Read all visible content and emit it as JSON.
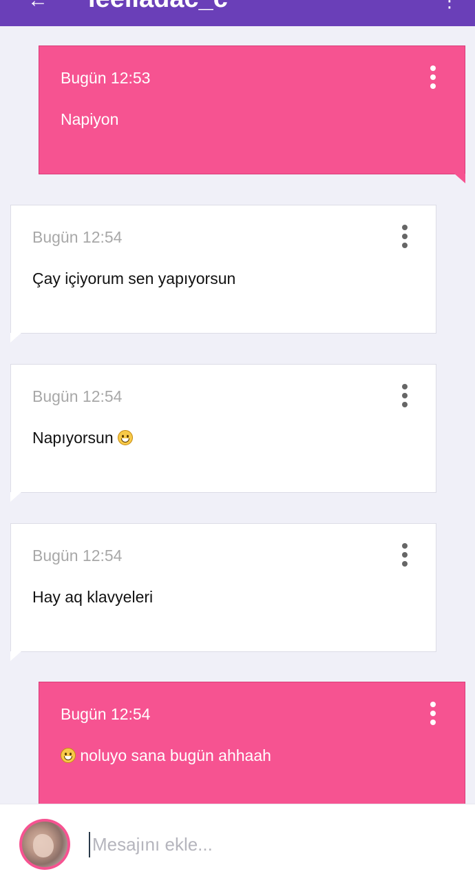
{
  "header": {
    "back_icon": "arrow-left-icon",
    "title": "leeiladac_c",
    "menu_icon": "more-vertical-icon",
    "background": "#6a3fb8"
  },
  "messages": [
    {
      "direction": "outgoing",
      "time": "Bugün 12:53",
      "text": "Napiyon",
      "emoji": null,
      "menu_icon": "more-vertical-icon"
    },
    {
      "direction": "incoming",
      "time": "Bugün 12:54",
      "text": "Çay içiyorum sen yapıyorsun",
      "emoji": null,
      "menu_icon": "more-vertical-icon"
    },
    {
      "direction": "incoming",
      "time": "Bugün 12:54",
      "text": "Napıyorsun",
      "emoji": "grinning-face-emoji",
      "menu_icon": "more-vertical-icon"
    },
    {
      "direction": "incoming",
      "time": "Bugün 12:54",
      "text": "Hay aq klavyeleri",
      "emoji": null,
      "menu_icon": "more-vertical-icon"
    },
    {
      "direction": "outgoing",
      "time": "Bugün 12:54",
      "text": "noluyo sana bugün ahhaah",
      "emoji": "grinning-face-emoji",
      "menu_icon": "more-vertical-icon"
    }
  ],
  "composer": {
    "placeholder": "Mesajını ekle...",
    "value": "",
    "avatar_icon": "user-avatar"
  },
  "colors": {
    "outgoing_bubble": "#f65391",
    "incoming_bubble": "#ffffff",
    "chat_background": "#f0f0f8"
  }
}
